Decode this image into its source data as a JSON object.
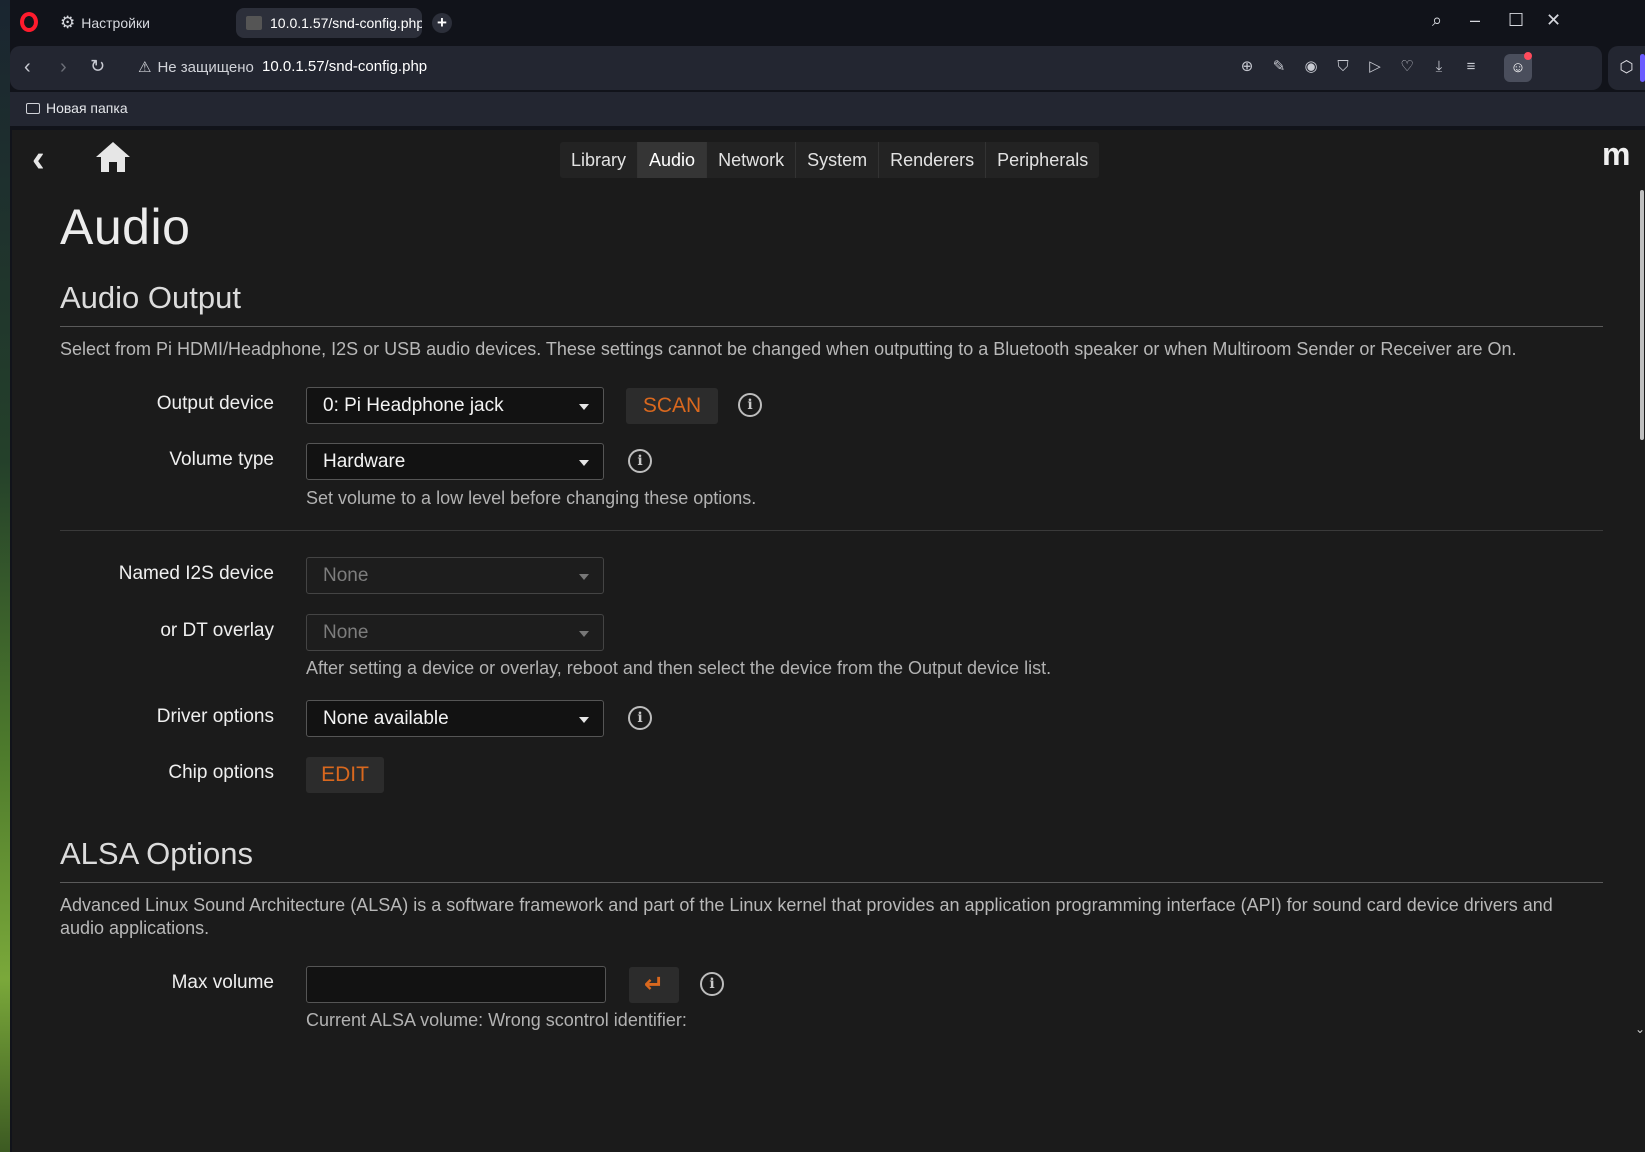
{
  "browser": {
    "tab_settings_label": "Настройки",
    "tab_active_label": "10.0.1.57/snd-config.php",
    "security_label": "Не защищено",
    "url": "10.0.1.57/snd-config.php",
    "bookmark_folder": "Новая папка"
  },
  "nav": {
    "tabs": [
      "Library",
      "Audio",
      "Network",
      "System",
      "Renderers",
      "Peripherals"
    ],
    "active": "Audio",
    "logo": "m"
  },
  "page": {
    "title": "Audio",
    "audio_output": {
      "title": "Audio Output",
      "description": "Select from Pi HDMI/Headphone, I2S or USB audio devices. These settings cannot be changed when outputting to a Bluetooth speaker or when Multiroom Sender or Receiver are On.",
      "output_device_label": "Output device",
      "output_device_value": "0: Pi Headphone jack",
      "scan_label": "SCAN",
      "volume_type_label": "Volume type",
      "volume_type_value": "Hardware",
      "volume_help": "Set volume to a low level before changing these options.",
      "named_i2s_label": "Named I2S device",
      "named_i2s_value": "None",
      "dt_overlay_label": "or DT overlay",
      "dt_overlay_value": "None",
      "overlay_help": "After setting a device or overlay, reboot and then select the device from the Output device list.",
      "driver_options_label": "Driver options",
      "driver_options_value": "None available",
      "chip_options_label": "Chip options",
      "edit_label": "EDIT"
    },
    "alsa": {
      "title": "ALSA Options",
      "description": "Advanced Linux Sound Architecture (ALSA) is a software framework and part of the Linux kernel that provides an application programming interface (API) for sound card device drivers and audio applications.",
      "max_volume_label": "Max volume",
      "max_volume_value": "",
      "submit_glyph": "↵",
      "current_volume_help": "Current ALSA volume: Wrong scontrol identifier:"
    }
  },
  "colors": {
    "accent": "#d9681e",
    "page_bg": "#1b1b1b",
    "chrome_bg": "#11131a"
  }
}
